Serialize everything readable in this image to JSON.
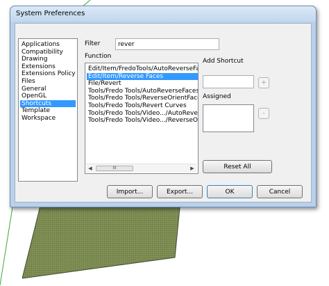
{
  "window": {
    "title": "System Preferences"
  },
  "categories": {
    "items": [
      "Applications",
      "Compatibility",
      "Drawing",
      "Extensions",
      "Extensions Policy",
      "Files",
      "General",
      "OpenGL",
      "Shortcuts",
      "Template",
      "Workspace"
    ],
    "selected_index": 8
  },
  "filter": {
    "label": "Filter",
    "value": "rever"
  },
  "function": {
    "label": "Function",
    "items": [
      "Edit/Item/FredoTools/AutoReverseFaces",
      "Edit/Item/Reverse Faces",
      "File/Revert",
      "Tools/Fredo Tools/AutoReverseFaces",
      "Tools/Fredo Tools/ReverseOrientFaces",
      "Tools/Fredo Tools/Revert Curves",
      "Tools/Fredo Tools/Video.../AutoReverseFaces",
      "Tools/Fredo Tools/Video.../ReverseOrientFaces"
    ],
    "selected_index": 1,
    "scroll_thumb": "III"
  },
  "shortcut": {
    "add_label": "Add Shortcut",
    "add_button": "+",
    "assigned_label": "Assigned",
    "remove_button": "-",
    "reset_button": "Reset All"
  },
  "buttons": {
    "import": "Import...",
    "export": "Export...",
    "ok": "OK",
    "cancel": "Cancel"
  }
}
